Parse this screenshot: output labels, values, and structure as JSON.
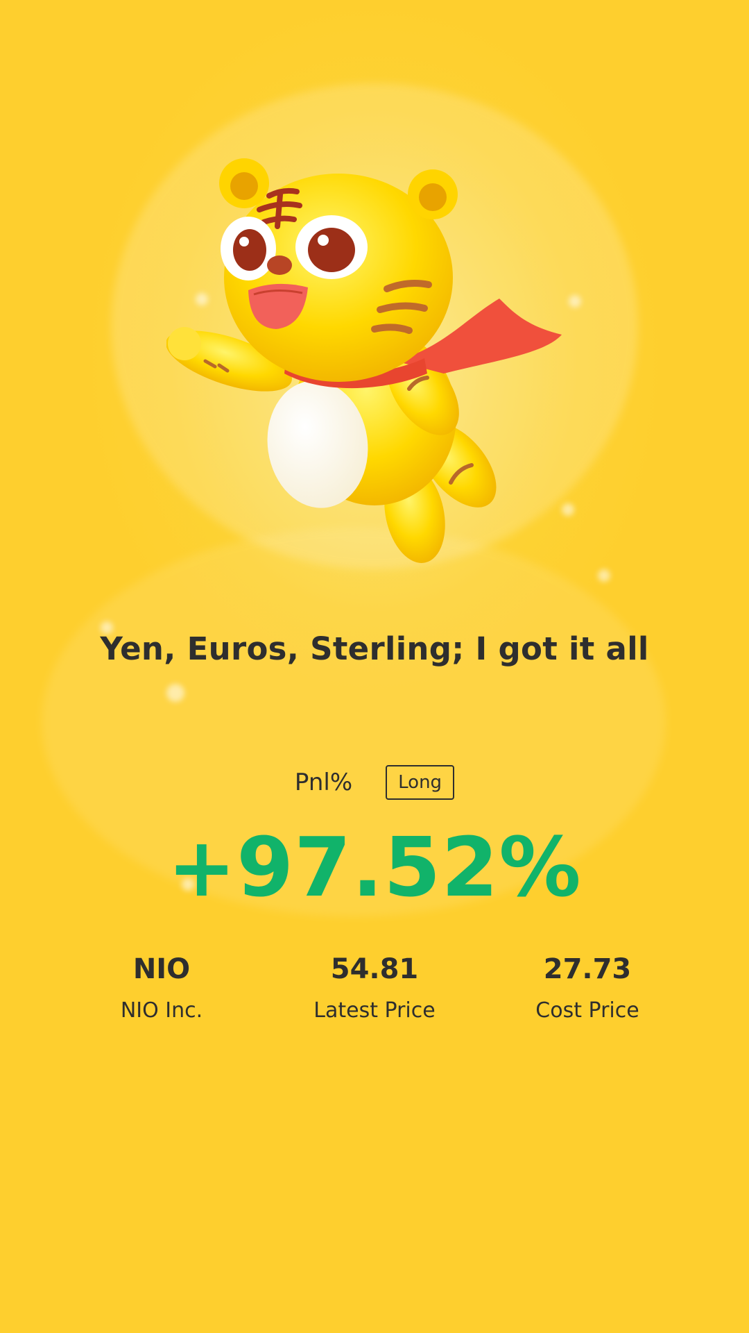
{
  "headline": "Yen, Euros, Sterling; I got it all",
  "pnl": {
    "label": "Pnl%",
    "direction": "Long",
    "value": "+97.52%"
  },
  "stats": [
    {
      "value": "NIO",
      "label": "NIO Inc."
    },
    {
      "value": "54.81",
      "label": "Latest Price"
    },
    {
      "value": "27.73",
      "label": "Cost Price"
    }
  ],
  "colors": {
    "background": "#fdd233",
    "gain": "#11b36a",
    "text": "#2e2e2e",
    "scarf": "#f0503c"
  },
  "icons": {
    "mascot": "tiger-mascot-icon"
  }
}
